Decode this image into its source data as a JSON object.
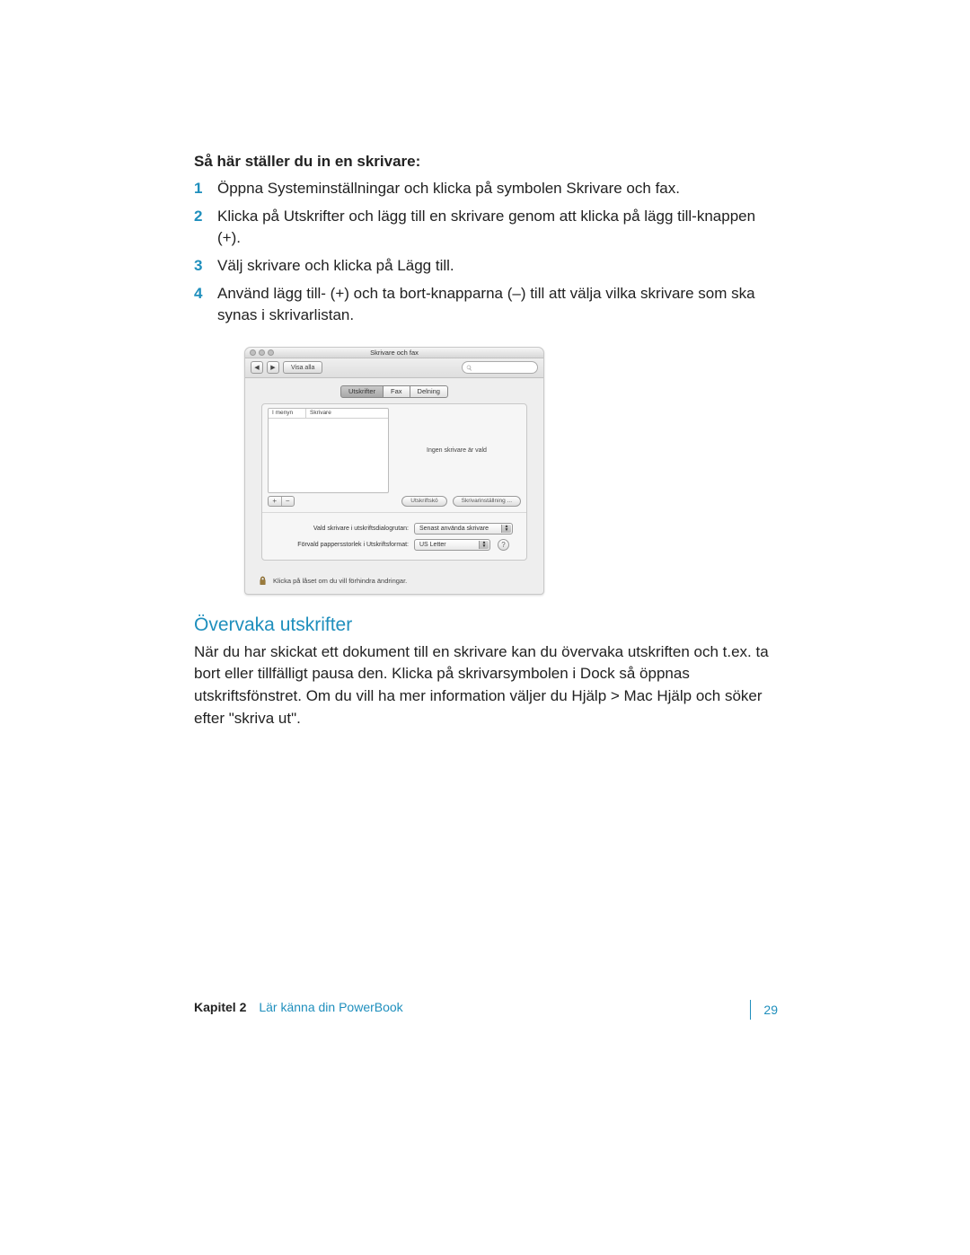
{
  "heading_setup": "Så här ställer du in en skrivare:",
  "steps": [
    "Öppna Systeminställningar och klicka på symbolen Skrivare och fax.",
    "Klicka på Utskrifter och lägg till en skrivare genom att klicka på lägg till-knappen (+).",
    "Välj skrivare och klicka på Lägg till.",
    "Använd lägg till- (+) och ta bort-knapparna (–) till att välja vilka skrivare som ska synas i skrivarlistan."
  ],
  "window": {
    "title": "Skrivare och fax",
    "nav_back": "◀",
    "nav_fwd": "▶",
    "show_all": "Visa alla",
    "tabs": {
      "print": "Utskrifter",
      "fax": "Fax",
      "share": "Delning"
    },
    "list_head_a": "I menyn",
    "list_head_b": "Skrivare",
    "empty_msg": "Ingen skrivare är vald",
    "add": "+",
    "remove": "−",
    "queue_btn": "Utskriftskö",
    "setup_btn": "Skrivarinställning ...",
    "row1_label": "Vald skrivare i utskriftsdialogrutan:",
    "row1_value": "Senast använda skrivare",
    "row2_label": "Förvald pappersstorlek i Utskriftsformat:",
    "row2_value": "US Letter",
    "help": "?",
    "lock_text": "Klicka på låset om du vill förhindra ändringar."
  },
  "blue_heading": "Övervaka utskrifter",
  "body": "När du har skickat ett dokument till en skrivare kan du övervaka utskriften och t.ex. ta bort eller tillfälligt pausa den. Klicka på skrivarsymbolen i Dock så öppnas utskriftsfönstret. Om du vill ha mer information väljer du Hjälp > Mac Hjälp och söker efter \"skriva ut\".",
  "footer": {
    "chapter": "Kapitel 2",
    "title": "Lär känna din PowerBook",
    "page": "29"
  }
}
